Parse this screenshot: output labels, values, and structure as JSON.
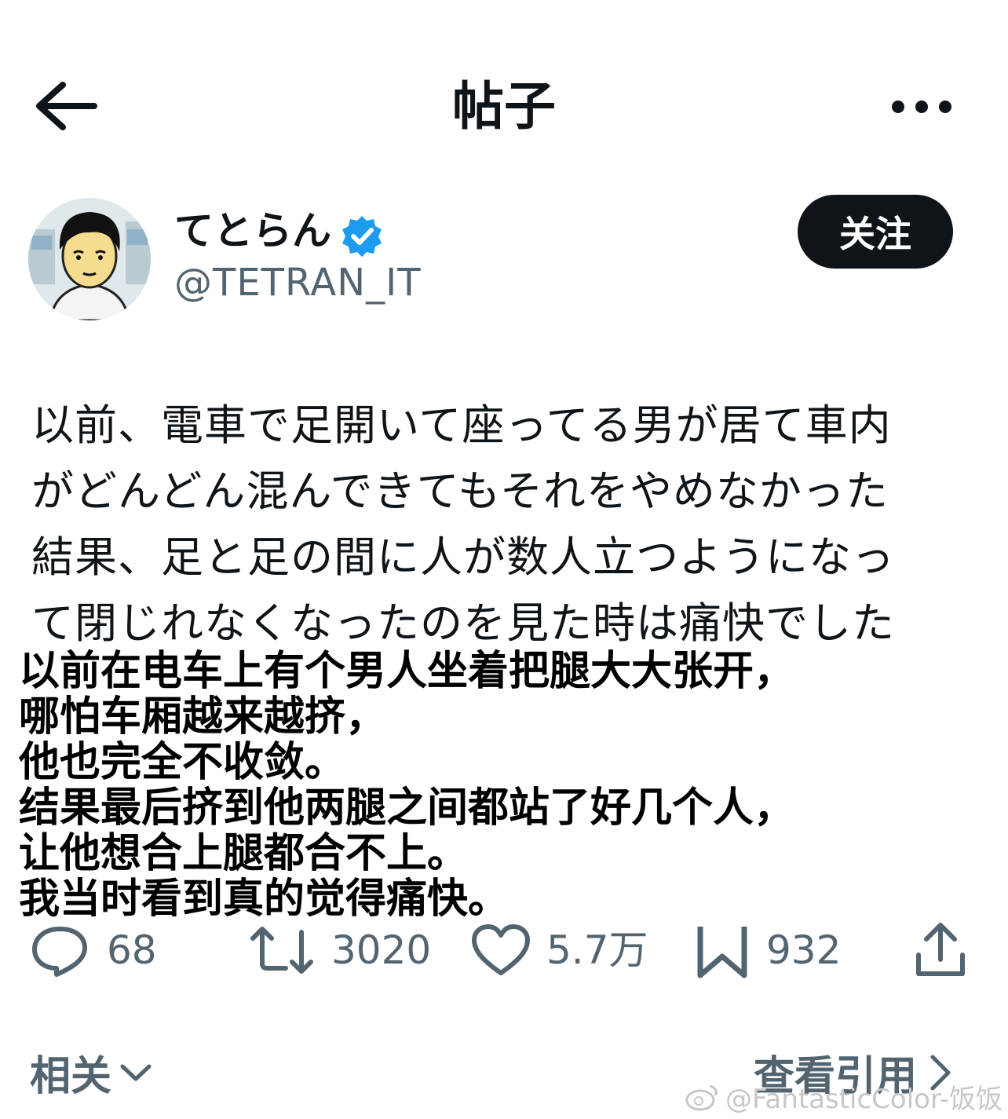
{
  "header": {
    "title": "帖子",
    "back_icon": "arrow-left-icon",
    "more_icon": "more-horizontal-icon"
  },
  "author": {
    "display_name": "てとらん",
    "handle": "@TETRAN_IT",
    "verified_icon": "verified-badge-icon",
    "verified_color": "#1d9bf0",
    "follow_label": "关注"
  },
  "post": {
    "original_lines": [
      "以前、電車で足開いて座ってる男が居て車内",
      "がどんどん混んできてもそれをやめなかった",
      "結果、足と足の間に人が数人立つようになっ",
      "て閉じれなくなったのを見た時は痛快でした"
    ],
    "translation_lines": [
      "以前在电车上有个男人坐着把腿大大张开，",
      "哪怕车厢越来越挤，",
      "他也完全不收敛。",
      "结果最后挤到他两腿之间都站了好几个人，",
      "让他想合上腿都合不上。",
      "我当时看到真的觉得痛快。"
    ]
  },
  "actions": {
    "reply_count": "68",
    "repost_count": "3020",
    "like_count": "5.7万",
    "bookmark_count": "932"
  },
  "footer": {
    "related_label": "相关",
    "quotes_label": "查看引用",
    "watermark": "@FantasticColor-饭饭"
  },
  "colors": {
    "text": "#0f1419",
    "secondary": "#536471",
    "button_bg": "#0f1419",
    "verified": "#1d9bf0"
  }
}
